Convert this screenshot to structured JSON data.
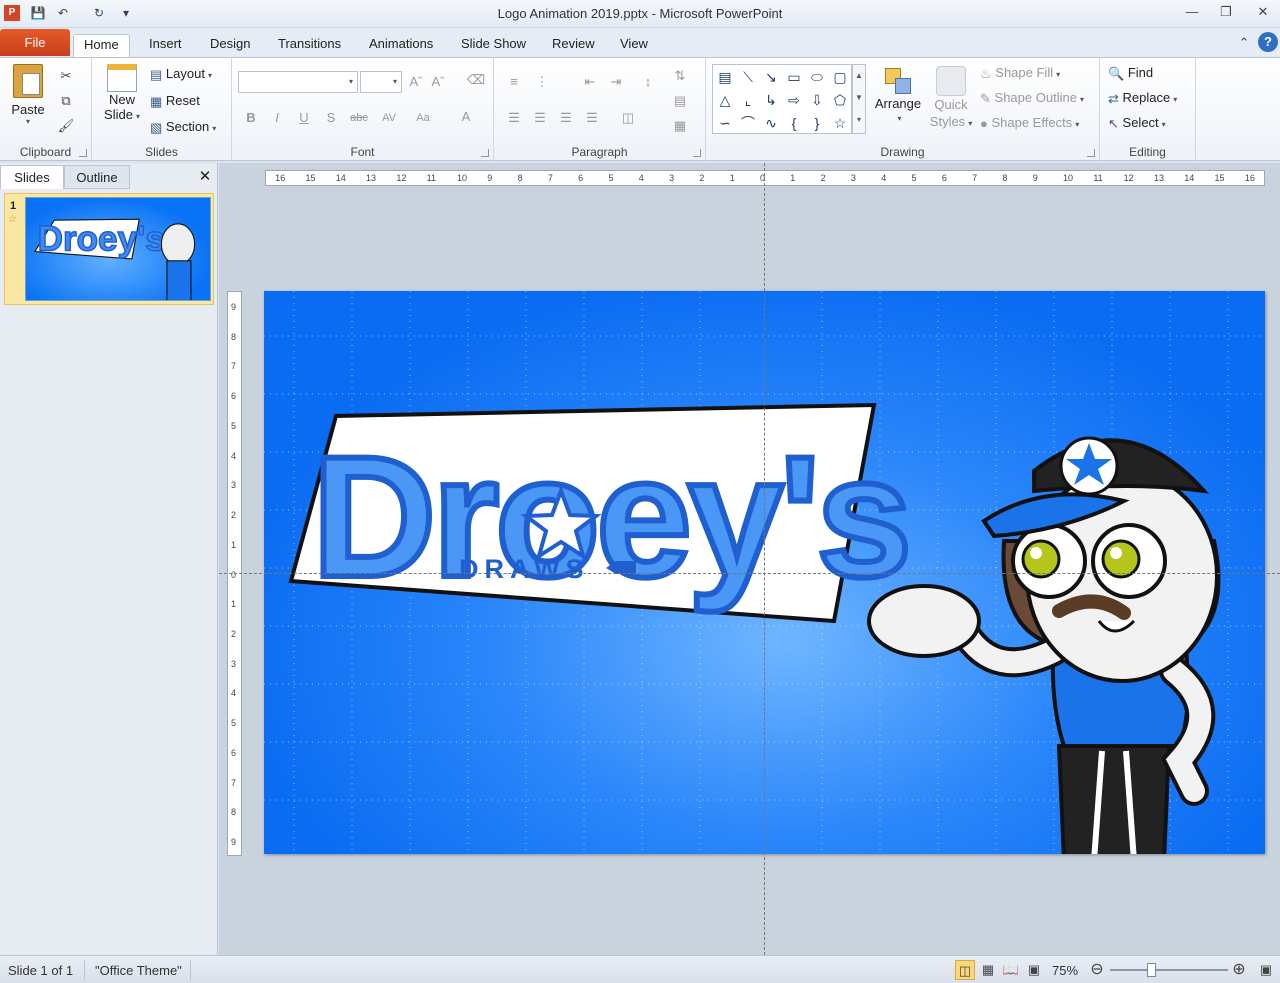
{
  "window": {
    "title": "Logo Animation 2019.pptx  -  Microsoft PowerPoint"
  },
  "qat": {
    "icons": [
      "powerpoint-icon",
      "save-icon",
      "undo-icon",
      "redo-icon",
      "customize-icon"
    ]
  },
  "tabs": {
    "file": "File",
    "items": [
      "Home",
      "Insert",
      "Design",
      "Transitions",
      "Animations",
      "Slide Show",
      "Review",
      "View"
    ],
    "active": "Home"
  },
  "ribbon": {
    "clipboard": {
      "name": "Clipboard",
      "paste": "Paste"
    },
    "slides": {
      "name": "Slides",
      "new_slide_1": "New",
      "new_slide_2": "Slide",
      "layout": "Layout",
      "reset": "Reset",
      "section": "Section"
    },
    "font": {
      "name": "Font",
      "font_value": "",
      "size_value": "",
      "bold": "B",
      "italic": "I",
      "underline": "U",
      "shadow": "S",
      "strike": "abc",
      "spacing": "AV",
      "case": "Aa",
      "color": "A"
    },
    "paragraph": {
      "name": "Paragraph"
    },
    "drawing": {
      "name": "Drawing",
      "arrange": "Arrange",
      "quick_styles_1": "Quick",
      "quick_styles_2": "Styles",
      "shape_fill": "Shape Fill",
      "shape_outline": "Shape Outline",
      "shape_effects": "Shape Effects"
    },
    "editing": {
      "name": "Editing",
      "find": "Find",
      "replace": "Replace",
      "select": "Select"
    }
  },
  "left_pane": {
    "tab_slides": "Slides",
    "tab_outline": "Outline",
    "slide_number": "1"
  },
  "rulers": {
    "horizontal": [
      "16",
      "15",
      "14",
      "13",
      "12",
      "11",
      "10",
      "9",
      "8",
      "7",
      "6",
      "5",
      "4",
      "3",
      "2",
      "1",
      "0",
      "1",
      "2",
      "3",
      "4",
      "5",
      "6",
      "7",
      "8",
      "9",
      "10",
      "11",
      "12",
      "13",
      "14",
      "15",
      "16"
    ],
    "vertical": [
      "9",
      "8",
      "7",
      "6",
      "5",
      "4",
      "3",
      "2",
      "1",
      "0",
      "1",
      "2",
      "3",
      "4",
      "5",
      "6",
      "7",
      "8",
      "9"
    ]
  },
  "slide": {
    "logo_main": "Droey's",
    "logo_sub": "DRAWS",
    "colors": {
      "bg": "#0a6cf2",
      "logo": "#1f5fd0"
    }
  },
  "status": {
    "slide": "Slide 1 of 1",
    "theme": "\"Office Theme\"",
    "zoom": "75%"
  }
}
